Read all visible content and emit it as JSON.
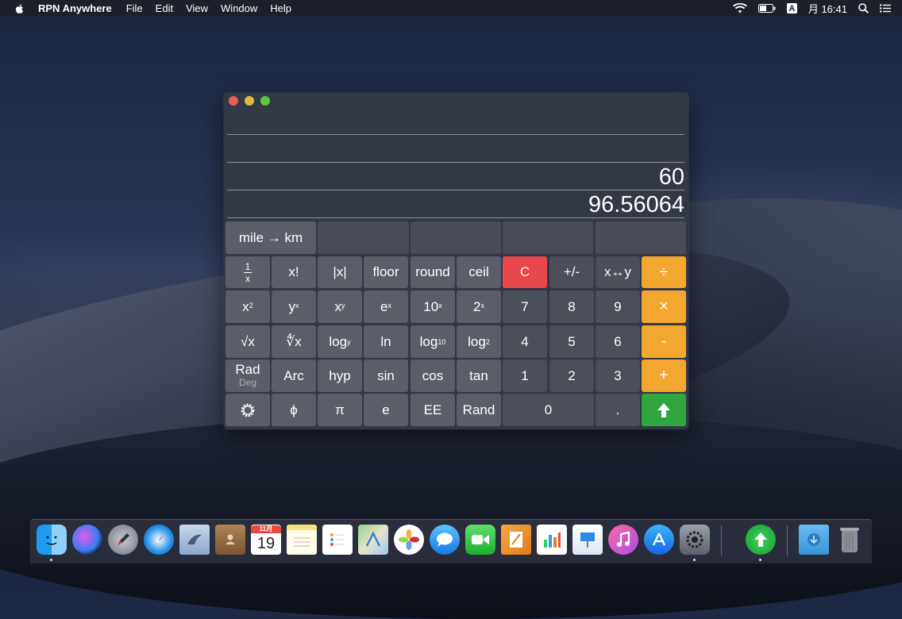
{
  "menubar": {
    "app_name": "RPN Anywhere",
    "items": [
      "File",
      "Edit",
      "View",
      "Window",
      "Help"
    ],
    "input_badge": "A",
    "clock": "月 16:41"
  },
  "display": {
    "stack": [
      "",
      "",
      "60",
      "96.56064"
    ]
  },
  "keys": {
    "preset": "mile → km",
    "inv_num": "1",
    "inv_den": "x",
    "fact": "x!",
    "abs": "|x|",
    "floor": "floor",
    "round": "round",
    "ceil": "ceil",
    "clear": "C",
    "negate": "+/-",
    "swap": "x↔y",
    "divide": "÷",
    "sq_base": "x",
    "sq_exp": "2",
    "pow_base": "y",
    "pow_exp": "x",
    "xpow_base": "x",
    "xpow_exp": "y",
    "exp_base": "e",
    "exp_exp": "x",
    "tenpow_base": "10",
    "tenpow_exp": "x",
    "twopow_base": "2",
    "twopow_exp": "x",
    "seven": "7",
    "eight": "8",
    "nine": "9",
    "multiply": "×",
    "sqrt": "√x",
    "yroot": "∜x",
    "logy_base": "log",
    "logy_sub": "y",
    "ln": "ln",
    "log10_base": "log",
    "log10_sub": "10",
    "log2_base": "log",
    "log2_sub": "2",
    "four": "4",
    "five": "5",
    "six": "6",
    "minus": "-",
    "rad": "Rad",
    "deg": "Deg",
    "arc": "Arc",
    "hyp": "hyp",
    "sin": "sin",
    "cos": "cos",
    "tan": "tan",
    "one": "1",
    "two": "2",
    "three": "3",
    "plus": "+",
    "phi": "ϕ",
    "pi": "π",
    "e": "e",
    "ee": "EE",
    "rand": "Rand",
    "zero": "0",
    "dot": ".",
    "enter": "⬆"
  },
  "colors": {
    "operator": "#f4a730",
    "clear": "#e8474c",
    "enter": "#2fa640"
  },
  "dock": {
    "icons": [
      "finder-icon",
      "siri-icon",
      "launchpad-icon",
      "safari-icon",
      "mail-icon",
      "contacts-icon",
      "calendar-icon",
      "notes-icon",
      "reminders-icon",
      "maps-icon",
      "photos-icon",
      "messages-icon",
      "facetime-icon",
      "pages-icon",
      "numbers-icon",
      "keynote-icon",
      "itunes-icon",
      "app-store-icon",
      "system-preferences-icon",
      "rpn-anywhere-icon",
      "downloads-folder-icon",
      "trash-icon"
    ],
    "calendar_month": "11月",
    "calendar_day": "19"
  }
}
